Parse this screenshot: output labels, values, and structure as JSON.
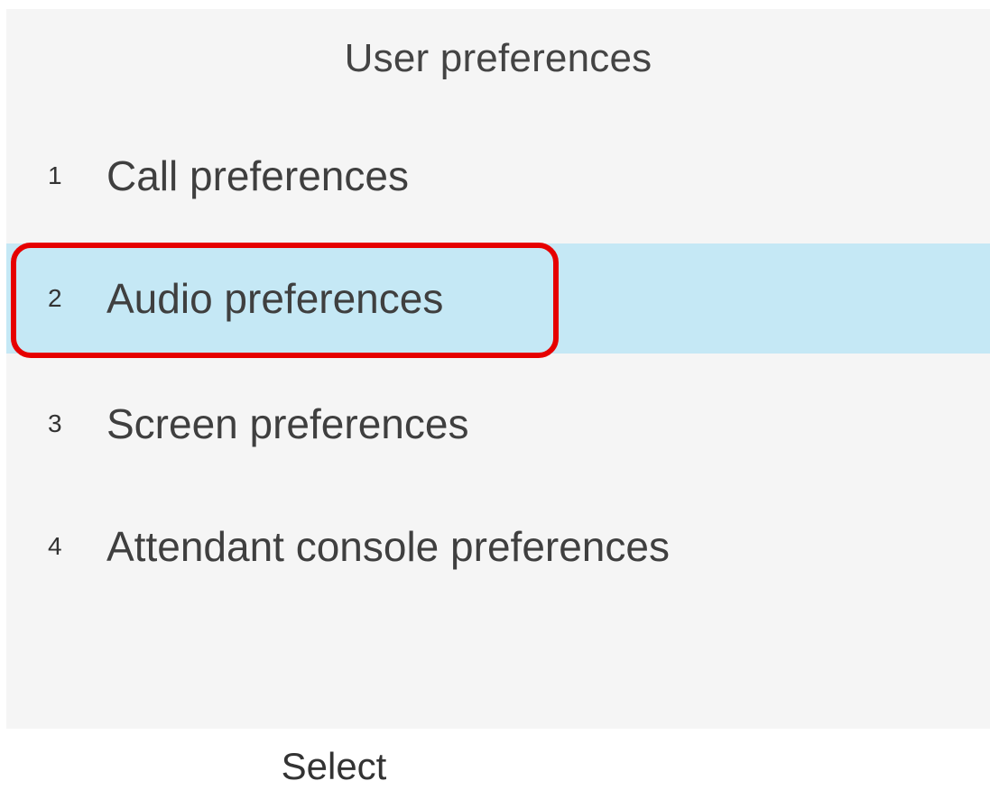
{
  "screen": {
    "title": "User preferences"
  },
  "menu": {
    "items": [
      {
        "number": "1",
        "label": "Call preferences",
        "selected": false
      },
      {
        "number": "2",
        "label": "Audio preferences",
        "selected": true
      },
      {
        "number": "3",
        "label": "Screen preferences",
        "selected": false
      },
      {
        "number": "4",
        "label": "Attendant console preferences",
        "selected": false
      }
    ]
  },
  "softkeys": {
    "select_label": "Select"
  },
  "colors": {
    "screen_background": "#f5f5f5",
    "selected_row": "#c5e8f5",
    "highlight_outline": "#e60000"
  }
}
